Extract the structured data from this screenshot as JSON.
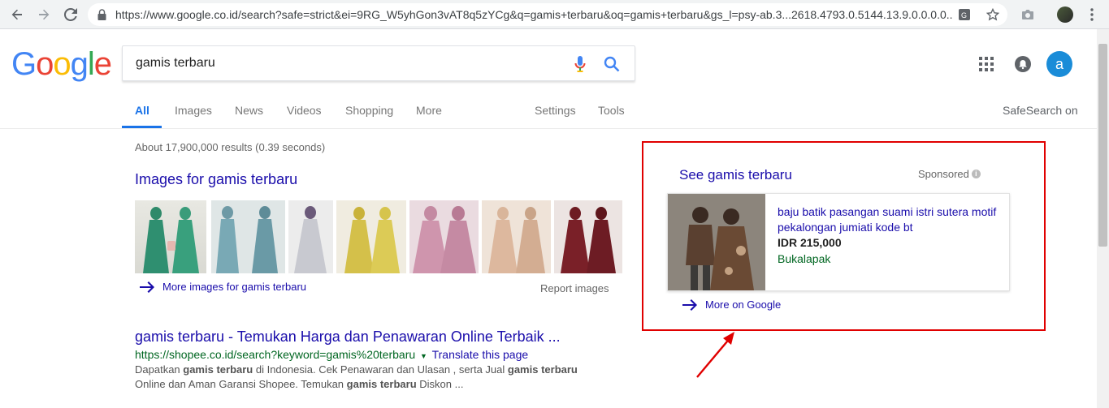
{
  "browser": {
    "url": "https://www.google.co.id/search?safe=strict&ei=9RG_W5yhGon3vAT8q5zYCg&q=gamis+terbaru&oq=gamis+terbaru&gs_l=psy-ab.3...2618.4793.0.5144.13.9.0.0.0.0..."
  },
  "header": {
    "logo": "Google",
    "search_value": "gamis terbaru",
    "avatar_letter": "a"
  },
  "tabs": {
    "all": "All",
    "images": "Images",
    "news": "News",
    "videos": "Videos",
    "shopping": "Shopping",
    "more": "More",
    "settings": "Settings",
    "tools": "Tools",
    "safesearch": "SafeSearch on"
  },
  "results": {
    "stats": "About 17,900,000 results (0.39 seconds)",
    "images_heading": "Images for gamis terbaru",
    "more_images": "More images for gamis terbaru",
    "report_images": "Report images",
    "first": {
      "title": "gamis terbaru - Temukan Harga dan Penawaran Online Terbaik ...",
      "url": "https://shopee.co.id/search?keyword=gamis%20terbaru",
      "translate": "Translate this page",
      "snippet_1": "Dapatkan ",
      "snippet_b1": "gamis terbaru",
      "snippet_2": " di Indonesia. Cek Penawaran dan Ulasan , serta Jual ",
      "snippet_b2": "gamis terbaru",
      "snippet_3": " Online dan Aman Garansi Shopee. Temukan ",
      "snippet_b3": "gamis terbaru",
      "snippet_4": " Diskon ..."
    }
  },
  "sponsored": {
    "title": "See gamis terbaru",
    "label": "Sponsored",
    "card_title": "baju batik pasangan suami istri sutera motif pekalongan jumiati kode bt",
    "price": "IDR 215,000",
    "merchant": "Bukalapak",
    "more_on_google": "More on Google"
  },
  "colors": {
    "link": "#1a0dab",
    "url_green": "#006621",
    "accent_blue": "#1a73e8",
    "highlight_red": "#e00000"
  }
}
